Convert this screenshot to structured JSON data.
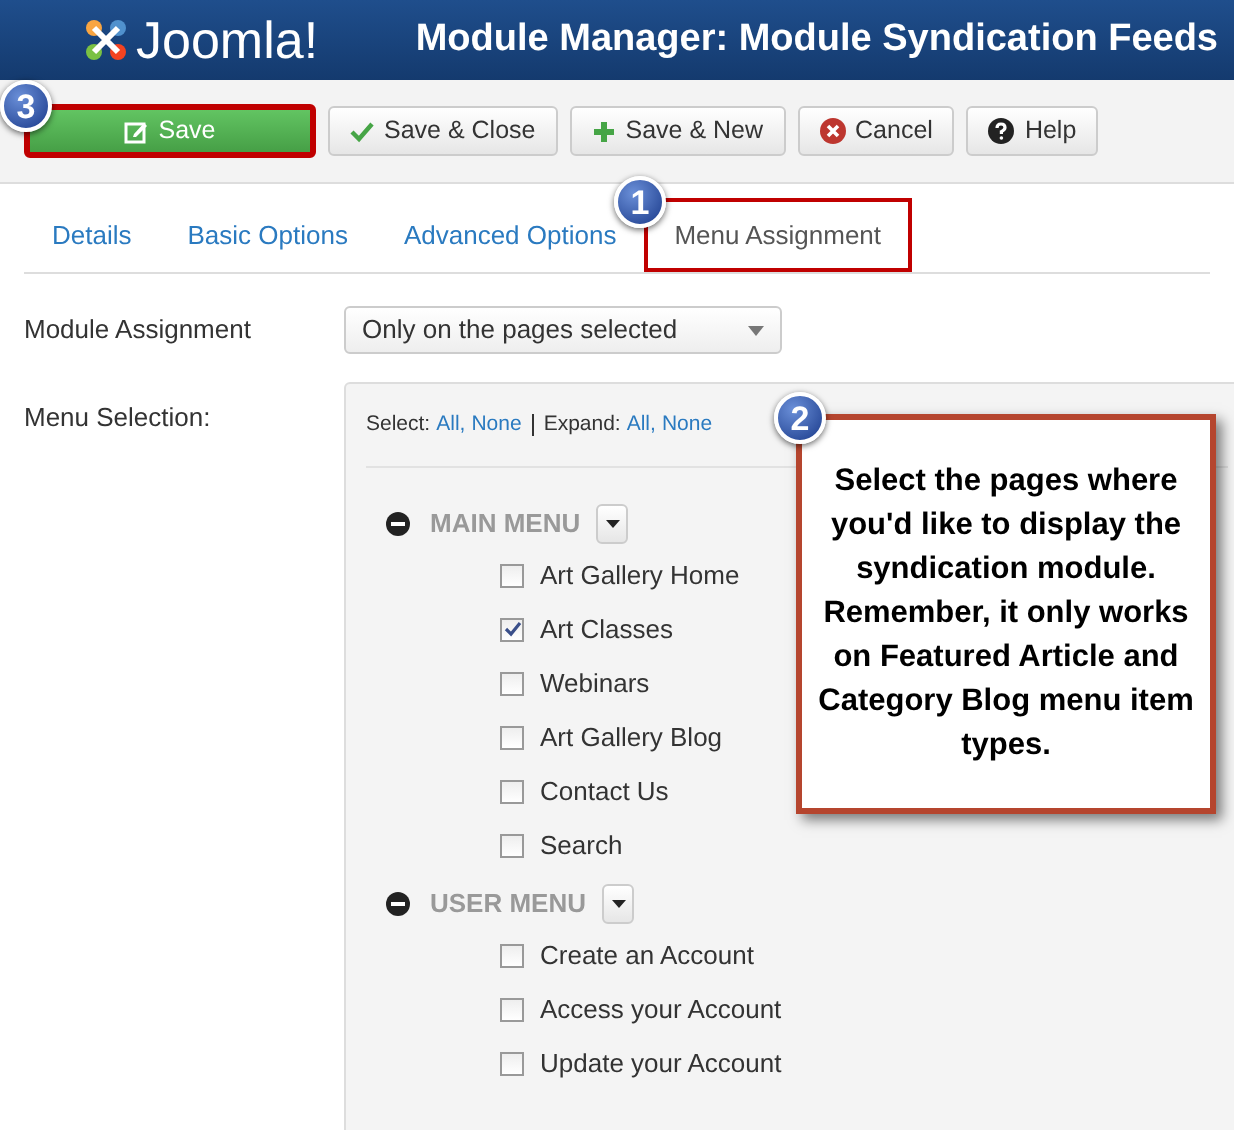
{
  "header": {
    "logo": "Joomla!",
    "title": "Module Manager: Module Syndication Feeds"
  },
  "toolbar": [
    {
      "kind": "save",
      "label": "Save",
      "highlighted": true
    },
    {
      "kind": "save-close",
      "label": "Save & Close",
      "highlighted": false
    },
    {
      "kind": "save-new",
      "label": "Save & New",
      "highlighted": false
    },
    {
      "kind": "cancel",
      "label": "Cancel",
      "highlighted": false
    },
    {
      "kind": "help",
      "label": "Help",
      "highlighted": false
    }
  ],
  "tabs": [
    {
      "label": "Details",
      "selected": false
    },
    {
      "label": "Basic Options",
      "selected": false
    },
    {
      "label": "Advanced Options",
      "selected": false
    },
    {
      "label": "Menu Assignment",
      "selected": true
    }
  ],
  "module_assignment": {
    "label": "Module Assignment",
    "value": "Only on the pages selected"
  },
  "menu_selection": {
    "label": "Menu Selection:",
    "select_label": "Select:",
    "select_all": "All,",
    "select_none": "None",
    "expand_label": "Expand:",
    "expand_all": "All,",
    "expand_none": "None",
    "menus": [
      {
        "title": "MAIN MENU",
        "items": [
          {
            "label": "Art Gallery Home",
            "checked": false
          },
          {
            "label": "Art Classes",
            "checked": true
          },
          {
            "label": "Webinars",
            "checked": false
          },
          {
            "label": "Art Gallery Blog",
            "checked": false
          },
          {
            "label": "Contact Us",
            "checked": false
          },
          {
            "label": "Search",
            "checked": false
          }
        ]
      },
      {
        "title": "USER MENU",
        "items": [
          {
            "label": "Create an Account",
            "checked": false
          },
          {
            "label": "Access your Account",
            "checked": false
          },
          {
            "label": "Update your Account",
            "checked": false
          }
        ]
      }
    ]
  },
  "callout": {
    "badge": "2",
    "text": "Select the pages where you'd like to display the syndication module. Remember, it only works on Featured Article and Category Blog menu item types."
  },
  "badges": [
    "1",
    "3"
  ]
}
